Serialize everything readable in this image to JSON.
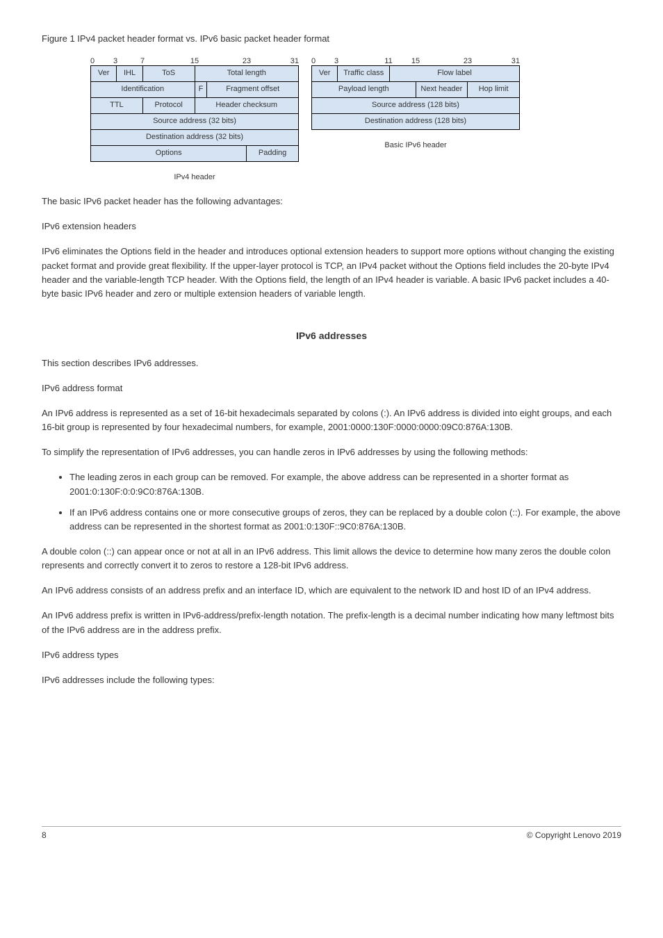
{
  "figure_caption": "Figure 1 IPv4 packet header format vs. IPv6 basic packet header format",
  "ruler_ticks": [
    "0",
    "3",
    "7",
    "15",
    "23",
    "31"
  ],
  "ipv4": {
    "ver": "Ver",
    "ihl": "IHL",
    "tos": "ToS",
    "total_length": "Total length",
    "identification": "Identification",
    "f": "F",
    "fragment_offset": "Fragment offset",
    "ttl": "TTL",
    "protocol": "Protocol",
    "header_checksum": "Header checksum",
    "src": "Source address (32 bits)",
    "dst": "Destination address (32 bits)",
    "options": "Options",
    "padding": "Padding",
    "caption": "IPv4 header"
  },
  "ipv6": {
    "ver": "Ver",
    "traffic_class": "Traffic class",
    "flow_label": "Flow label",
    "payload_length": "Payload length",
    "next_header": "Next header",
    "hop_limit": "Hop limit",
    "src": "Source address (128 bits)",
    "dst": "Destination address (128 bits)",
    "caption": "Basic IPv6 header"
  },
  "para1": "The basic IPv6 packet header has the following advantages:",
  "para2": "IPv6 extension headers",
  "para3": "IPv6 eliminates the Options field in the header and introduces optional extension headers to support more options without changing the existing packet format and provide great flexibility. If the upper-layer protocol is TCP, an IPv4 packet without the Options field includes the 20-byte IPv4 header and the variable-length TCP header. With the Options field, the length of an IPv4 header is variable. A basic IPv6 packet includes a 40-byte basic IPv6 header and zero or multiple extension headers of variable length.",
  "section_heading": "IPv6 addresses",
  "para4": "This section describes IPv6 addresses.",
  "format_heading": "IPv6 address format",
  "para5": "An IPv6 address is represented as a set of 16-bit hexadecimals separated by colons (:). An IPv6 address is divided into eight groups, and each 16-bit group is represented by four hexadecimal numbers, for example, 2001:0000:130F:0000:0000:09C0:876A:130B.",
  "para6": "To simplify the representation of IPv6 addresses, you can handle zeros in IPv6 addresses by using the following methods:",
  "bullets": [
    "The leading zeros in each group can be removed. For example, the above address can be represented in a shorter format as 2001:0:130F:0:0:9C0:876A:130B.",
    "If an IPv6 address contains one or more consecutive groups of zeros, they can be replaced by a double colon (::). For example, the above address can be represented in the shortest format as 2001:0:130F::9C0:876A:130B."
  ],
  "note": "A double colon (::) can appear once or not at all in an IPv6 address. This limit allows the device to determine how many zeros the double colon represents and correctly convert it to zeros to restore a 128-bit IPv6 address.",
  "para7": "An IPv6 address consists of an address prefix and an interface ID, which are equivalent to the network ID and host ID of an IPv4 address.",
  "para8": "An IPv6 address prefix is written in IPv6-address/prefix-length notation. The prefix-length is a decimal number indicating how many leftmost bits of the IPv6 address are in the address prefix.",
  "types_heading": "IPv6 address types",
  "para9": "IPv6 addresses include the following types:",
  "footer_left": "8",
  "footer_right": "© Copyright Lenovo 2019"
}
